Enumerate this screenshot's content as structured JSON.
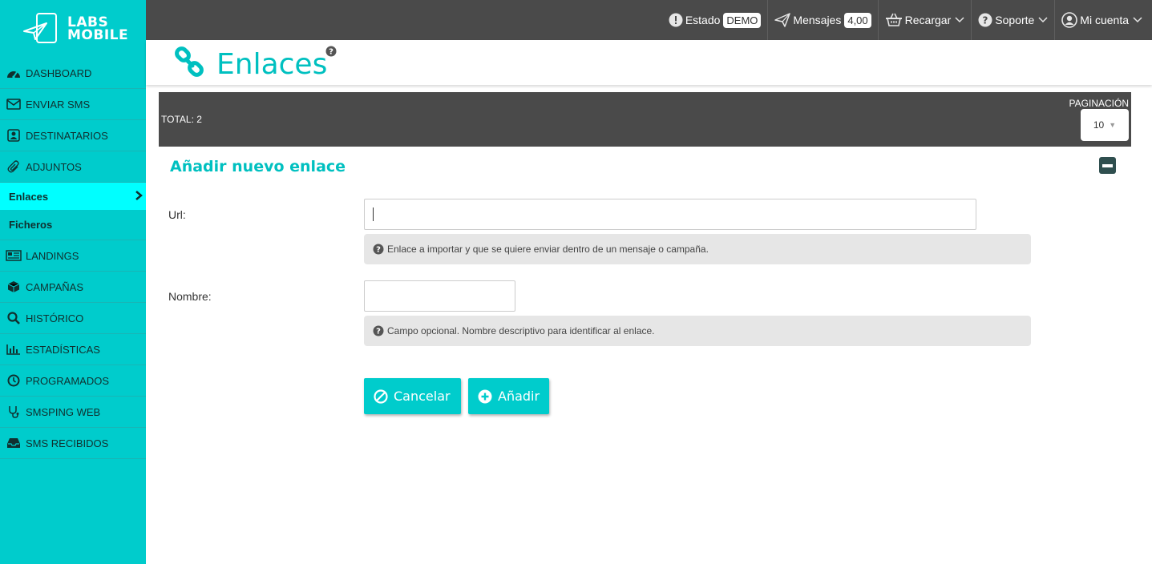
{
  "logo": {
    "line1": "LABS",
    "line2": "MOBILE"
  },
  "sidebar": {
    "items": [
      {
        "label": "DASHBOARD",
        "icon": "dashboard-icon"
      },
      {
        "label": "ENVIAR SMS",
        "icon": "envelope-icon"
      },
      {
        "label": "DESTINATARIOS",
        "icon": "contact-card-icon"
      },
      {
        "label": "ADJUNTOS",
        "icon": "paperclip-icon"
      },
      {
        "label": "Enlaces",
        "icon": "chevron-right-icon"
      },
      {
        "label": "Ficheros"
      },
      {
        "label": "LANDINGS",
        "icon": "newspaper-icon"
      },
      {
        "label": "CAMPAÑAS",
        "icon": "cube-icon"
      },
      {
        "label": "HISTÓRICO",
        "icon": "search-icon"
      },
      {
        "label": "ESTADÍSTICAS",
        "icon": "bar-chart-icon"
      },
      {
        "label": "PROGRAMADOS",
        "icon": "clock-icon"
      },
      {
        "label": "SMSPING WEB",
        "icon": "stethoscope-icon"
      },
      {
        "label": "SMS RECIBIDOS",
        "icon": "inbox-icon"
      }
    ]
  },
  "topbar": {
    "estado_label": "Estado",
    "estado_badge": "DEMO",
    "mensajes_label": "Mensajes",
    "mensajes_badge": "4,00",
    "recargar_label": "Recargar",
    "soporte_label": "Soporte",
    "cuenta_label": "Mi cuenta"
  },
  "page": {
    "title": "Enlaces"
  },
  "list_bar": {
    "total": "TOTAL: 2",
    "pagination_label": "PAGINACIÓN",
    "pagination_value": "10"
  },
  "form": {
    "section_title": "Añadir nuevo enlace",
    "url_label": "Url:",
    "url_value": "",
    "url_hint": "Enlace a importar y que se quiere enviar dentro de un mensaje o campaña.",
    "name_label": "Nombre:",
    "name_value": "",
    "name_hint": "Campo opcional. Nombre descriptivo para identificar al enlace.",
    "cancel_label": "Cancelar",
    "add_label": "Añadir"
  },
  "colors": {
    "accent": "#00cccc",
    "active_item": "#00ffff",
    "dark_bar": "#4a4a4a",
    "title_teal": "#00c0c0"
  }
}
